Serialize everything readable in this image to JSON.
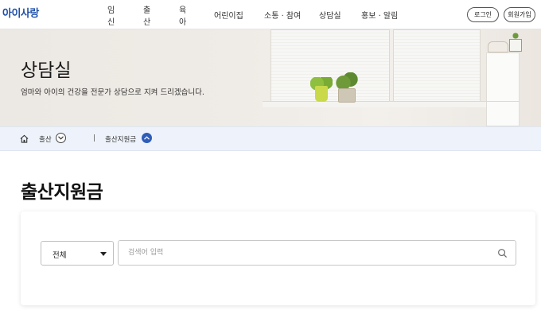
{
  "header": {
    "logo": "아이사랑",
    "nav": [
      "임신",
      "출산",
      "육아",
      "어린이집",
      "소통 · 참여",
      "상담실",
      "홍보 · 알림"
    ],
    "login_label": "로그인",
    "join_label": "회원가입"
  },
  "banner": {
    "title": "상담실",
    "subtitle": "엄마와 아이의 건강을 전문가 상담으로 지켜 드리겠습니다."
  },
  "breadcrumb": {
    "level1": "출산",
    "separator": "|",
    "level2": "출산지원금"
  },
  "page": {
    "title": "출산지원금"
  },
  "search": {
    "category_selected": "전체",
    "placeholder": "검색어 입력",
    "value": ""
  },
  "colors": {
    "brand": "#1f4fa8",
    "breadcrumb_bg": "#eef3fb",
    "active_toggle": "#2f5db8"
  }
}
